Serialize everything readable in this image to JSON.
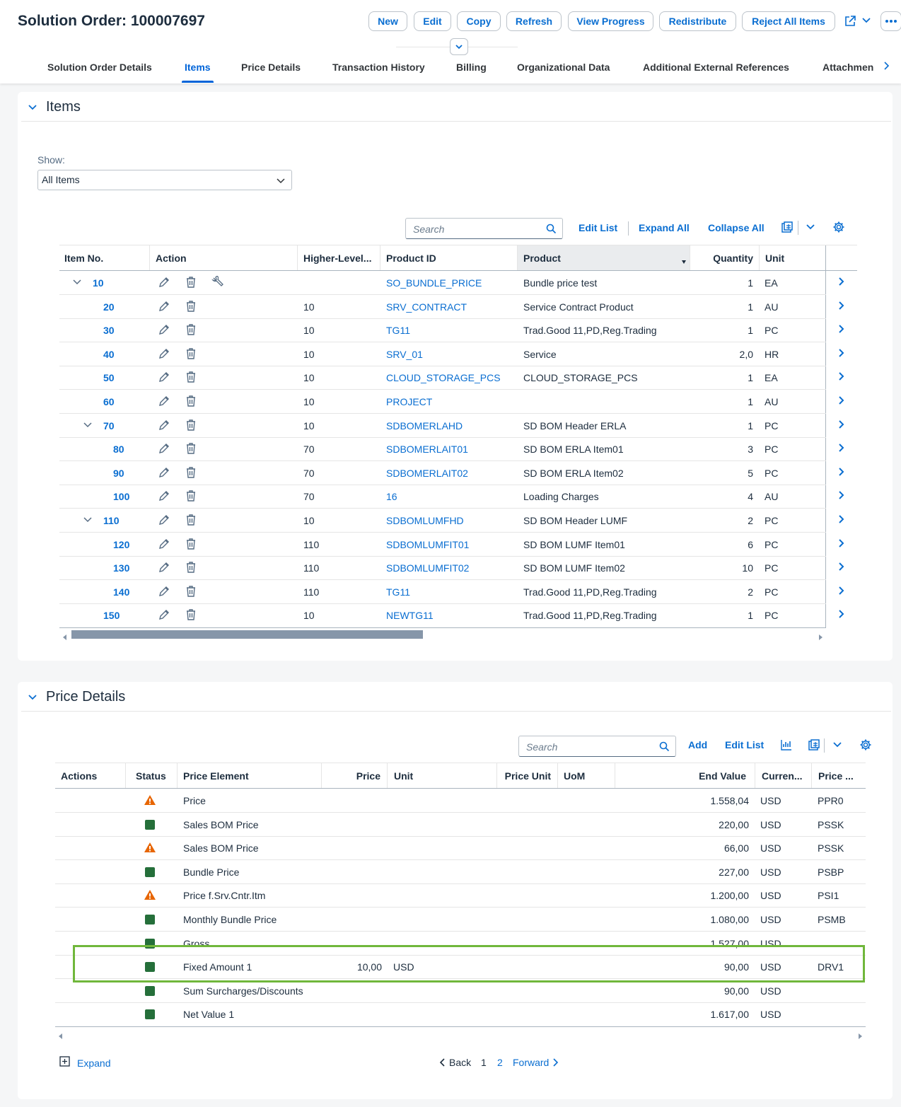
{
  "header": {
    "title": "Solution Order: 100007697",
    "buttons": [
      "New",
      "Edit",
      "Copy",
      "Refresh",
      "View Progress",
      "Redistribute",
      "Reject All Items"
    ],
    "tabs": [
      "Solution Order Details",
      "Items",
      "Price Details",
      "Transaction History",
      "Billing",
      "Organizational Data",
      "Additional External References",
      "Attachmen"
    ],
    "active_tab": "Items"
  },
  "items_section": {
    "title": "Items",
    "show_label": "Show:",
    "show_value": "All Items",
    "search_placeholder": "Search",
    "toolbar": [
      "Edit List",
      "Expand All",
      "Collapse All"
    ],
    "columns": [
      "Item No.",
      "Action",
      "Higher-Level...",
      "Product ID",
      "Product",
      "Quantity",
      "Unit"
    ],
    "rows": [
      {
        "item": "10",
        "expandable": true,
        "level": 0,
        "higher": "",
        "product_id": "SO_BUNDLE_PRICE",
        "product": "Bundle price test",
        "qty": "1",
        "unit": "EA",
        "wrench": true
      },
      {
        "item": "20",
        "expandable": false,
        "level": 1,
        "higher": "10",
        "product_id": "SRV_CONTRACT",
        "product": "Service Contract Product",
        "qty": "1",
        "unit": "AU"
      },
      {
        "item": "30",
        "expandable": false,
        "level": 1,
        "higher": "10",
        "product_id": "TG11",
        "product": "Trad.Good 11,PD,Reg.Trading",
        "qty": "1",
        "unit": "PC"
      },
      {
        "item": "40",
        "expandable": false,
        "level": 1,
        "higher": "10",
        "product_id": "SRV_01",
        "product": "Service",
        "qty": "2,0",
        "unit": "HR"
      },
      {
        "item": "50",
        "expandable": false,
        "level": 1,
        "higher": "10",
        "product_id": "CLOUD_STORAGE_PCS",
        "product": "CLOUD_STORAGE_PCS",
        "qty": "1",
        "unit": "EA"
      },
      {
        "item": "60",
        "expandable": false,
        "level": 1,
        "higher": "10",
        "product_id": "PROJECT",
        "product": "",
        "qty": "1",
        "unit": "AU"
      },
      {
        "item": "70",
        "expandable": true,
        "level": 1,
        "higher": "10",
        "product_id": "SDBOMERLAHD",
        "product": "SD BOM Header ERLA",
        "qty": "1",
        "unit": "PC"
      },
      {
        "item": "80",
        "expandable": false,
        "level": 2,
        "higher": "70",
        "product_id": "SDBOMERLAIT01",
        "product": "SD BOM ERLA Item01",
        "qty": "3",
        "unit": "PC"
      },
      {
        "item": "90",
        "expandable": false,
        "level": 2,
        "higher": "70",
        "product_id": "SDBOMERLAIT02",
        "product": "SD BOM ERLA Item02",
        "qty": "5",
        "unit": "PC"
      },
      {
        "item": "100",
        "expandable": false,
        "level": 2,
        "higher": "70",
        "product_id": "16",
        "product": "Loading Charges",
        "qty": "4",
        "unit": "AU"
      },
      {
        "item": "110",
        "expandable": true,
        "level": 1,
        "higher": "10",
        "product_id": "SDBOMLUMFHD",
        "product": "SD BOM Header LUMF",
        "qty": "2",
        "unit": "PC"
      },
      {
        "item": "120",
        "expandable": false,
        "level": 2,
        "higher": "110",
        "product_id": "SDBOMLUMFIT01",
        "product": "SD BOM LUMF Item01",
        "qty": "6",
        "unit": "PC"
      },
      {
        "item": "130",
        "expandable": false,
        "level": 2,
        "higher": "110",
        "product_id": "SDBOMLUMFIT02",
        "product": "SD BOM LUMF Item02",
        "qty": "10",
        "unit": "PC"
      },
      {
        "item": "140",
        "expandable": false,
        "level": 2,
        "higher": "110",
        "product_id": "TG11",
        "product": "Trad.Good 11,PD,Reg.Trading",
        "qty": "2",
        "unit": "PC"
      },
      {
        "item": "150",
        "expandable": false,
        "level": 1,
        "higher": "10",
        "product_id": "NEWTG11",
        "product": "Trad.Good 11,PD,Reg.Trading",
        "qty": "1",
        "unit": "PC"
      }
    ]
  },
  "price_section": {
    "title": "Price Details",
    "search_placeholder": "Search",
    "toolbar": [
      "Add",
      "Edit List"
    ],
    "columns": [
      "Actions",
      "Status",
      "Price Element",
      "Price",
      "Unit",
      "Price Unit",
      "UoM",
      "End Value",
      "Curren...",
      "Price ..."
    ],
    "rows": [
      {
        "status": "warning",
        "element": "Price",
        "price": "",
        "unit": "",
        "end_value": "1.558,04",
        "currency": "USD",
        "cond": "PPR0"
      },
      {
        "status": "ok",
        "element": "Sales BOM Price",
        "price": "",
        "unit": "",
        "end_value": "220,00",
        "currency": "USD",
        "cond": "PSSK"
      },
      {
        "status": "warning",
        "element": "Sales BOM Price",
        "price": "",
        "unit": "",
        "end_value": "66,00",
        "currency": "USD",
        "cond": "PSSK"
      },
      {
        "status": "ok",
        "element": "Bundle Price",
        "price": "",
        "unit": "",
        "end_value": "227,00",
        "currency": "USD",
        "cond": "PSBP"
      },
      {
        "status": "warning",
        "element": "Price f.Srv.Cntr.Itm",
        "price": "",
        "unit": "",
        "end_value": "1.200,00",
        "currency": "USD",
        "cond": "PSI1"
      },
      {
        "status": "ok",
        "element": "Monthly Bundle Price",
        "price": "",
        "unit": "",
        "end_value": "1.080,00",
        "currency": "USD",
        "cond": "PSMB"
      },
      {
        "status": "ok",
        "element": "Gross",
        "price": "",
        "unit": "",
        "end_value": "1.527,00",
        "currency": "USD",
        "cond": ""
      },
      {
        "status": "ok",
        "element": "Fixed Amount 1",
        "price": "10,00",
        "unit": "USD",
        "end_value": "90,00",
        "currency": "USD",
        "cond": "DRV1"
      },
      {
        "status": "ok",
        "element": "Sum Surcharges/Discounts",
        "price": "",
        "unit": "",
        "end_value": "90,00",
        "currency": "USD",
        "cond": ""
      },
      {
        "status": "ok",
        "element": "Net Value 1",
        "price": "",
        "unit": "",
        "end_value": "1.617,00",
        "currency": "USD",
        "cond": ""
      }
    ],
    "expand_label": "Expand",
    "pager": {
      "back": "Back",
      "pages": [
        "1",
        "2"
      ],
      "forward": "Forward"
    }
  },
  "colors": {
    "accent": "#0a6ed1",
    "success": "#256f3a",
    "warning": "#e76500",
    "highlight": "#70b73b"
  }
}
